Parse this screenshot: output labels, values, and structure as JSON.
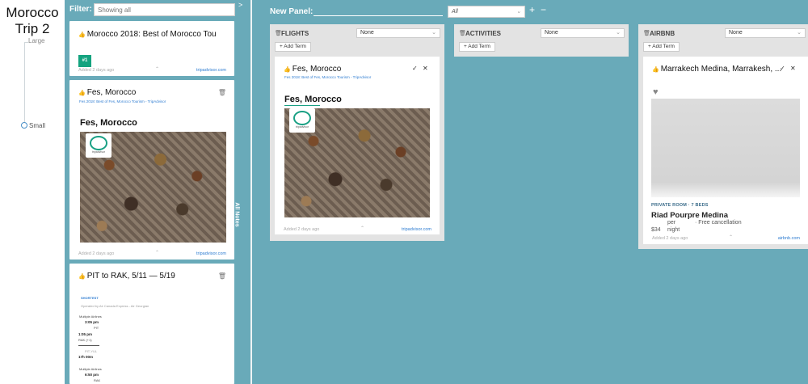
{
  "rail": {
    "title": "Morocco Trip 2",
    "size_large": "Large",
    "size_small": "Small"
  },
  "notes": {
    "filter_label": "Filter:",
    "filter_placeholder": "Showing all",
    "collapse_label": ">",
    "side_tab_label": "All Notes",
    "cards": [
      {
        "title": "Morocco 2018: Best of Morocco Tou",
        "rank_badge": "#1",
        "added": "Added 2 days ago",
        "source": "tripadvisor.com"
      },
      {
        "title": "Fes, Morocco",
        "sub_link": "Fes 2018: Best of Fes, Morocco Tourism - TripAdvisor",
        "heading": "Fes, Morocco",
        "badge_text": "tripadvisor",
        "added": "Added 2 days ago",
        "source": "tripadvisor.com"
      },
      {
        "title": "PIT to RAK, 5/11 — 5/19",
        "tag": "SHORTEST",
        "operator": "Operated by Air Canada Express - Air Georgian",
        "seg1_airline": "Multiple Airlines",
        "seg1_depart": "3:05 pm",
        "seg1_from": "PIT",
        "seg1_arrive": "1:05 pm",
        "seg1_to": "RAK (+1)",
        "seg1_stop": "PIT-YUL",
        "seg1_duration": "17h 00m",
        "seg2_airline": "Multiple Airlines",
        "seg2_depart": "6:50 pm",
        "seg2_from": "RAK"
      }
    ]
  },
  "board": {
    "new_panel_label": "New Panel:",
    "select_value": "All",
    "add_label": "+",
    "remove_label": "−",
    "panels": [
      {
        "title": "FLIGHTS",
        "select": "None",
        "add_term": "+ Add Term",
        "card": {
          "title": "Fes, Morocco",
          "sub_link": "Fes 2018: Best of Fes, Morocco Tourism - TripAdvisor",
          "heading": "Fes, Morocco",
          "badge_text": "tripadvisor",
          "added": "Added 2 days ago",
          "source": "tripadvisor.com"
        }
      },
      {
        "title": "ACTIVITIES",
        "select": "None",
        "add_term": "+ Add Term"
      },
      {
        "title": "AIRBNB",
        "select": "None",
        "add_term": "+ Add Term",
        "card": {
          "title": "Marrakech Medina, Marrakesh, ...",
          "room_type": "PRIVATE ROOM · 7 BEDS",
          "name": "Riad Pourpre Medina",
          "price": "$34",
          "per": "per",
          "night": "night",
          "cancellation": "· Free cancellation",
          "added": "Added 2 days ago",
          "source": "airbnb.com"
        }
      }
    ]
  },
  "colors": {
    "background": "#69aab9",
    "link": "#2e7cd1",
    "badge": "#14a37f"
  }
}
